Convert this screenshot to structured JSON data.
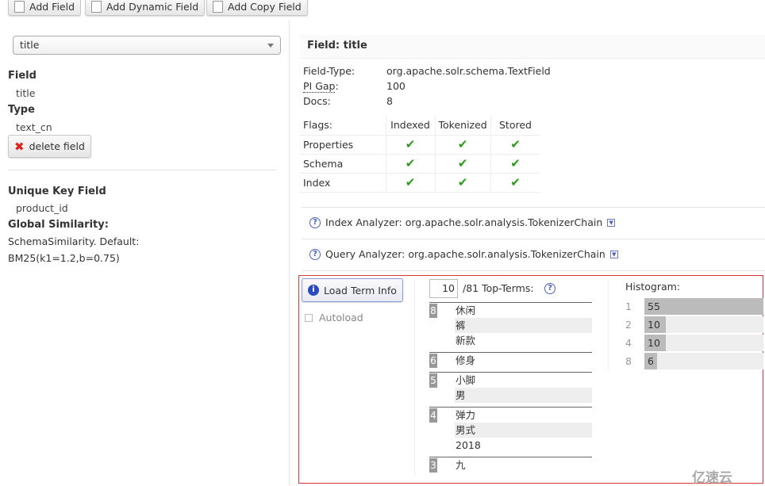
{
  "toolbar": {
    "add_field": "Add Field",
    "add_dynamic_field": "Add Dynamic Field",
    "add_copy_field": "Add Copy Field"
  },
  "left": {
    "field_select": "title",
    "field_label": "Field",
    "field_value": "title",
    "type_label": "Type",
    "type_value": "text_cn",
    "delete_label": "delete field",
    "unique_key_label": "Unique Key Field",
    "unique_key_value": "product_id",
    "similarity_label": "Global Similarity:",
    "similarity_line1": "SchemaSimilarity. Default:",
    "similarity_line2": "BM25(k1=1.2,b=0.75)"
  },
  "field": {
    "title": "Field: title",
    "field_type_label": "Field-Type:",
    "field_type": "org.apache.solr.schema.TextField",
    "pi_gap_label": "PI Gap",
    "pi_gap": "100",
    "docs_label": "Docs:",
    "docs": "8",
    "flags": {
      "header": "Flags:",
      "columns": [
        "Indexed",
        "Tokenized",
        "Stored"
      ],
      "rows": [
        {
          "label": "Properties",
          "values": [
            true,
            true,
            true
          ]
        },
        {
          "label": "Schema",
          "values": [
            true,
            true,
            true
          ]
        },
        {
          "label": "Index",
          "values": [
            true,
            true,
            true
          ]
        }
      ]
    },
    "index_analyzer": "Index Analyzer: org.apache.solr.analysis.TokenizerChain",
    "query_analyzer": "Query Analyzer: org.apache.solr.analysis.TokenizerChain"
  },
  "terms": {
    "load_button": "Load Term Info",
    "autoload_label": "Autoload",
    "autoload_checked": false,
    "top_n": "10",
    "total_label": "/81 Top-Terms:",
    "groups": [
      {
        "count": "8",
        "terms": [
          "休闲",
          "裤",
          "新款"
        ]
      },
      {
        "count": "6",
        "terms": [
          "修身"
        ]
      },
      {
        "count": "5",
        "terms": [
          "小脚",
          "男"
        ]
      },
      {
        "count": "4",
        "terms": [
          "弹力",
          "男式",
          "2018"
        ]
      },
      {
        "count": "3",
        "terms": [
          "九"
        ]
      }
    ],
    "histogram_label": "Histogram:",
    "histogram": [
      {
        "key": "1",
        "value": 55
      },
      {
        "key": "2",
        "value": 10
      },
      {
        "key": "4",
        "value": 10
      },
      {
        "key": "8",
        "value": 6
      }
    ]
  },
  "watermark": "亿速云",
  "colors": {
    "highlight_border": "#d9363e",
    "check": "#2a9a1a"
  }
}
